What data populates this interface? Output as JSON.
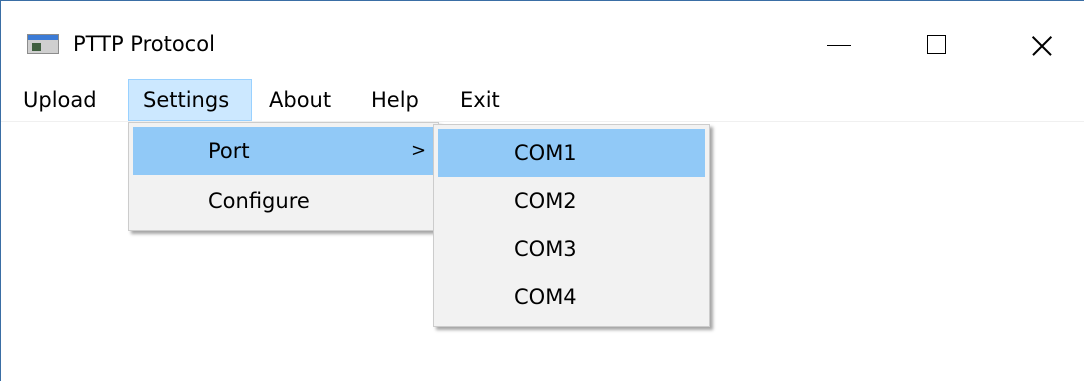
{
  "window": {
    "title": "PTTP Protocol",
    "icon": "app-window-icon",
    "controls": {
      "minimize": "minimize-icon",
      "maximize": "maximize-icon",
      "close": "close-icon"
    }
  },
  "menubar": {
    "items": [
      {
        "label": "Upload"
      },
      {
        "label": "Settings",
        "state": "open"
      },
      {
        "label": "About"
      },
      {
        "label": "Help"
      },
      {
        "label": "Exit"
      }
    ]
  },
  "settings_menu": {
    "items": [
      {
        "label": "Port",
        "submenu_arrow": ">",
        "highlighted": true
      },
      {
        "label": "Configure"
      }
    ]
  },
  "port_menu": {
    "items": [
      {
        "label": "COM1",
        "highlighted": true
      },
      {
        "label": "COM2"
      },
      {
        "label": "COM3"
      },
      {
        "label": "COM4"
      }
    ]
  },
  "colors": {
    "menu_highlight": "#91c9f7",
    "menubar_active": "#cce8ff",
    "menu_background": "#f2f2f2"
  }
}
